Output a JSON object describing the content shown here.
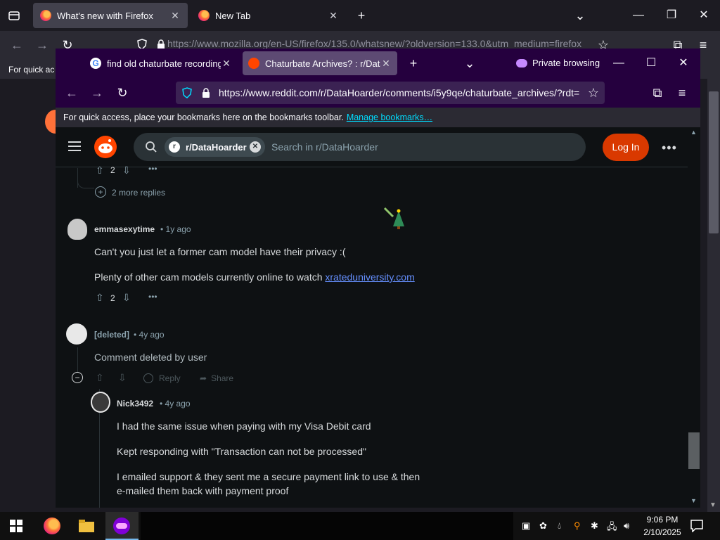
{
  "back_window": {
    "tabs": [
      {
        "label": "What's new with Firefox"
      },
      {
        "label": "New Tab"
      }
    ],
    "url": "https://www.mozilla.org/en-US/firefox/135.0/whatsnew/?oldversion=133.0&utm_medium=firefox",
    "bookmarks_text": "For quick access"
  },
  "front_window": {
    "tabs": [
      {
        "label": "find old chaturbate recordings"
      },
      {
        "label": "Chaturbate Archives? : r/DataHoarder"
      }
    ],
    "private_label": "Private browsing",
    "url": "https://www.reddit.com/r/DataHoarder/comments/i5y9qe/chaturbate_archives/?rdt=",
    "bookmarks_bar": {
      "text": "For quick access, place your bookmarks here on the bookmarks toolbar.",
      "link": "Manage bookmarks…"
    }
  },
  "reddit": {
    "subreddit_chip": "r/DataHoarder",
    "search_placeholder": "Search in r/DataHoarder",
    "login_label": "Log In",
    "top_vote_count": "2",
    "more_replies": "2 more replies",
    "comments": [
      {
        "username": "emmasexytime",
        "age": "• 1y ago",
        "paragraphs": [
          "Can't you just let a former cam model have their privacy :(",
          "Plenty of other cam models currently online to watch "
        ],
        "link": "xrateduniversity.com",
        "votes": "2"
      },
      {
        "username": "[deleted]",
        "age": "• 4y ago",
        "paragraphs": [
          "Comment deleted by user"
        ],
        "actions": {
          "reply": "Reply",
          "share": "Share"
        }
      },
      {
        "username": "Nick3492",
        "age": "• 4y ago",
        "paragraphs": [
          "I had the same issue when paying with my Visa Debit card",
          "Kept responding with \"Transaction can not be processed\"",
          "I emailed support & they sent me a secure payment link to use & then",
          "e-mailed them back with payment proof"
        ]
      }
    ]
  },
  "taskbar": {
    "time": "9:06 PM",
    "date": "2/10/2025"
  },
  "colors": {
    "private_bg": "#25003e",
    "reddit_bg": "#0e1113",
    "login_button": "#d93900",
    "link": "#648efc"
  }
}
